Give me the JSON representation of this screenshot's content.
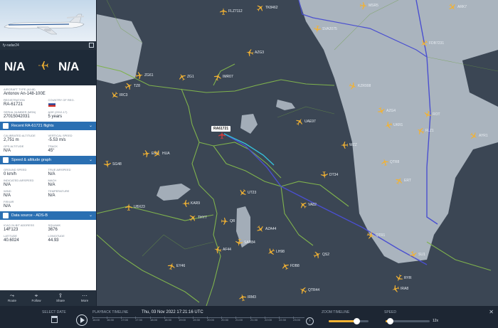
{
  "panel": {
    "photo_credit": "fy-radar24",
    "route": {
      "from": "N/A",
      "to": "N/A"
    },
    "aircraft_type_label": "AIRCRAFT TYPE (A148)",
    "aircraft_type": "Antonov An-148-100E",
    "registration_label": "REGISTRATION",
    "registration": "RA-61721",
    "country_label": "COUNTRY OF REG.",
    "serial_label": "SERIAL NUMBER (MSN)",
    "serial": "27015042031",
    "age_label": "AGE (2012-17)",
    "age": "5 years",
    "recent_flights": "Recent RA-61721 flights",
    "calibrated_altitude_label": "CALIBRATED ALTITUDE",
    "calibrated_altitude": "2,751 m",
    "vertical_speed_label": "VERTICAL SPEED",
    "vertical_speed": "-5.53 m/s",
    "gps_altitude_label": "GPS ALTITUDE",
    "gps_altitude": "N/A",
    "track_label": "TRACK",
    "track": "45°",
    "speed_section": "Speed & altitude graph",
    "ground_speed_label": "GROUND SPEED",
    "ground_speed": "0 km/h",
    "true_airspeed_label": "TRUE AIRSPEED",
    "true_airspeed": "N/A",
    "indicated_airspeed_label": "INDICATED AIRSPEED",
    "indicated_airspeed": "N/A",
    "mach_label": "MACH",
    "mach": "N/A",
    "wind_label": "WIND",
    "wind": "N/A",
    "temperature_label": "TEMPERATURE",
    "temperature": "N/A",
    "fir_label": "FIR/UIR",
    "fir": "N/A",
    "data_section": "Data source - ADS-B",
    "icao_label": "ICAO 24-BIT ADDRESS",
    "icao": "14F123",
    "squawk_label": "SQUAWK",
    "squawk": "3676",
    "latitude_label": "LATITUDE",
    "latitude": "40.6024",
    "longitude_label": "LONGITUDE",
    "longitude": "44.93",
    "bottom": [
      "Route",
      "Follow",
      "Share",
      "More"
    ]
  },
  "map": {
    "selected_label": "RA61721",
    "aircraft": [
      {
        "label": "FLZ7112"
      },
      {
        "label": "TK8462"
      },
      {
        "label": "MSR5"
      },
      {
        "label": "ARK7"
      },
      {
        "label": "SVA2075"
      },
      {
        "label": "FDB7231"
      },
      {
        "label": "AZG3"
      },
      {
        "label": "ZG1"
      },
      {
        "label": "IMR07"
      },
      {
        "label": "TZ8"
      },
      {
        "label": "KZR908"
      },
      {
        "label": "AZG4"
      },
      {
        "label": "ROT"
      },
      {
        "label": "UKR1"
      },
      {
        "label": "FLZ1"
      },
      {
        "label": "QTR8"
      },
      {
        "label": "ERT"
      },
      {
        "label": "EIA8"
      },
      {
        "label": "HUA"
      },
      {
        "label": "SG48"
      },
      {
        "label": "UT23"
      },
      {
        "label": "KAR9"
      },
      {
        "label": "VA82"
      },
      {
        "label": "UBX23"
      },
      {
        "label": "THY7"
      },
      {
        "label": "QR"
      },
      {
        "label": "AZA44"
      },
      {
        "label": "SAR84"
      },
      {
        "label": "LH98"
      },
      {
        "label": "AF44"
      },
      {
        "label": "FDB8"
      },
      {
        "label": "EY46"
      },
      {
        "label": "QS2"
      },
      {
        "label": "QTR1"
      },
      {
        "label": "SU1"
      },
      {
        "label": "RYR"
      },
      {
        "label": "IRA8"
      },
      {
        "label": "QTR44"
      },
      {
        "label": "IRM3"
      },
      {
        "label": "UAE97"
      },
      {
        "label": "ZG61"
      },
      {
        "label": "AYR1"
      },
      {
        "label": "DT34"
      },
      {
        "label": "IRC3"
      },
      {
        "label": "WZZ"
      }
    ]
  },
  "playback": {
    "select_date": "SELECT DATE",
    "timeline_title": "PLAYBACK TIMELINE",
    "timeline_value": "Thu, 03 Nov 2022 17:21:16 UTC",
    "ticks": [
      "16:00",
      "16:30",
      "17:00",
      "17:30",
      "18:00",
      "18:30",
      "19:00",
      "19:30",
      "20:00",
      "20:30",
      "21:00",
      "21:30",
      "22:00",
      "22:30",
      "23:00"
    ],
    "zoom_title": "ZOOM TIMELINE",
    "zoom_value": 0.7,
    "speed_title": "SPEED",
    "speed_value_label": "12x",
    "speed_value": 0.1
  },
  "colors": {
    "sea": "#aab4be",
    "land": "#3b4654",
    "border": "#7fb24d",
    "route": "#4a4fd0",
    "plane": "#f2b233",
    "accent": "#2a6fb2"
  }
}
